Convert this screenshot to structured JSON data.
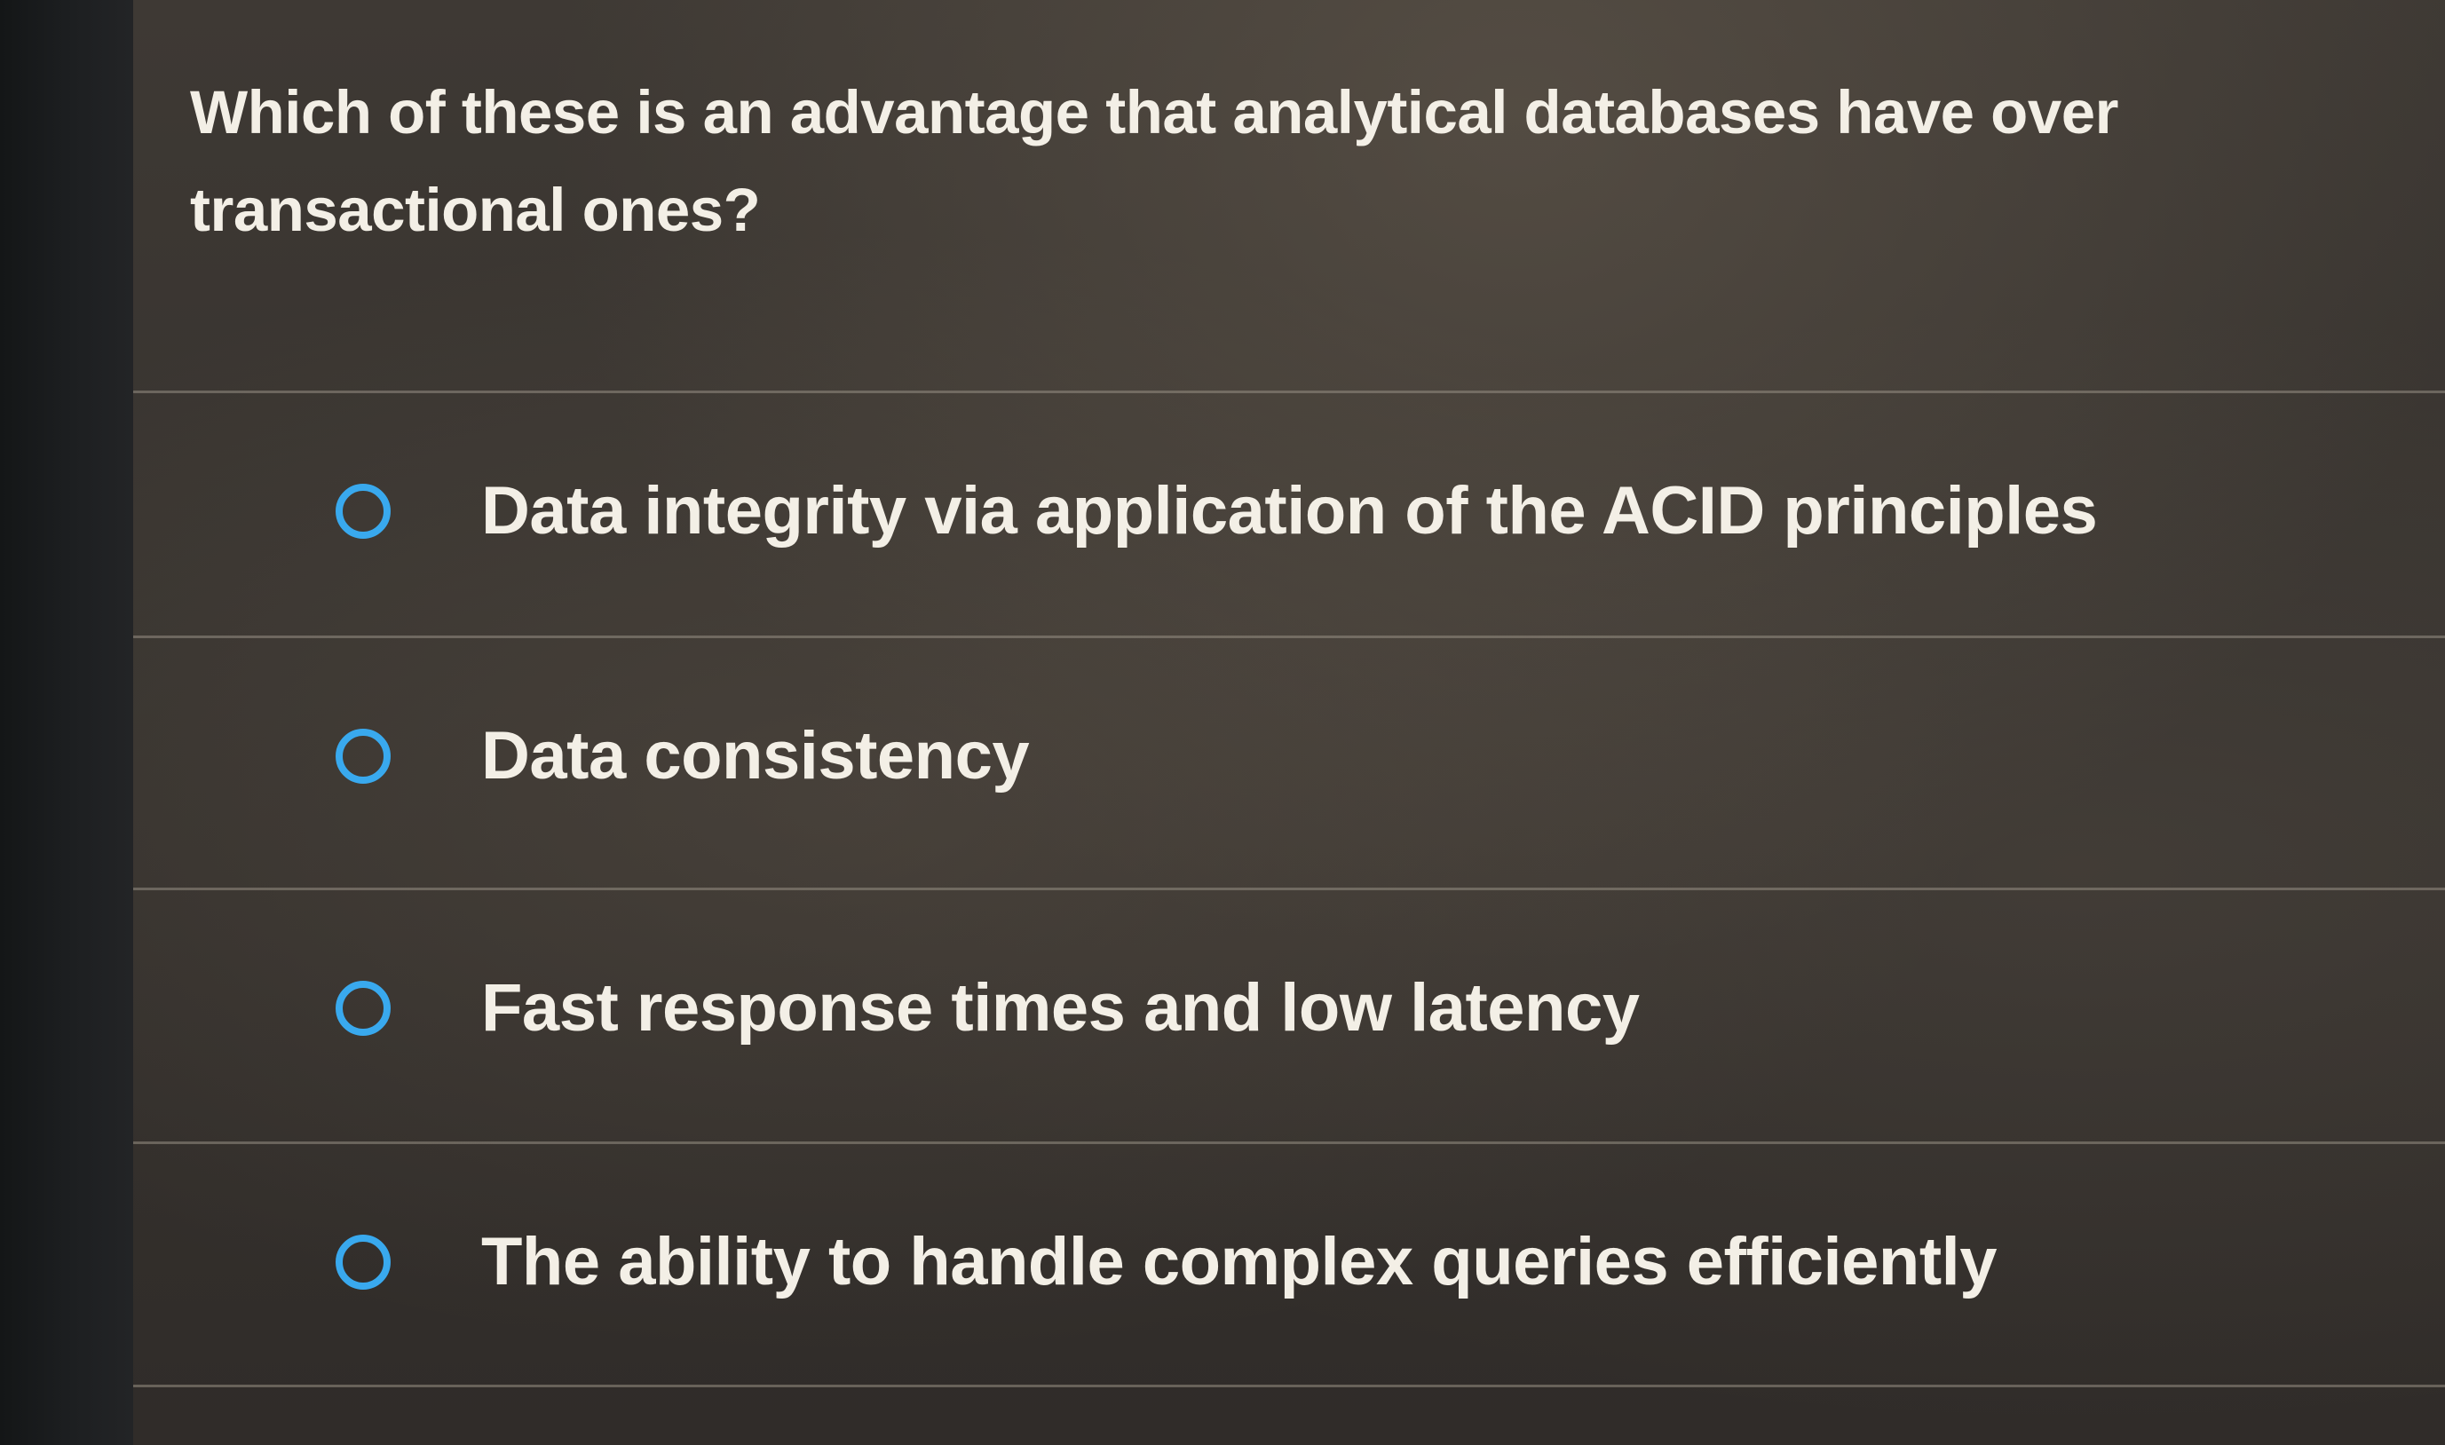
{
  "question": {
    "text": "Which of these is an advantage that analytical databases have over transactional ones?"
  },
  "options": [
    {
      "label": "Data integrity via application of the ACID principles",
      "selected": false
    },
    {
      "label": "Data consistency",
      "selected": false
    },
    {
      "label": "Fast response times and low latency",
      "selected": false
    },
    {
      "label": "The ability to handle complex queries efficiently",
      "selected": false
    }
  ],
  "colors": {
    "radio_accent": "#39a9ee",
    "text": "#f3efe6",
    "background": "#37332f"
  }
}
